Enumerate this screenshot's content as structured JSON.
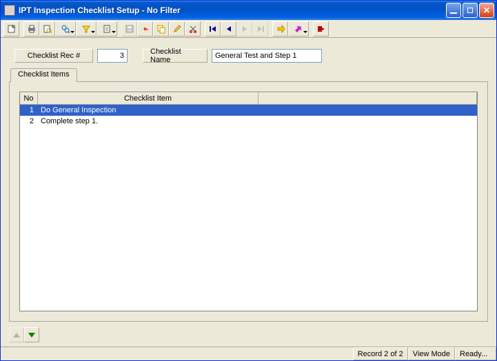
{
  "window": {
    "title": "IPT Inspection Checklist Setup - No Filter"
  },
  "form": {
    "rec_label": "Checklist Rec #",
    "rec_value": "3",
    "name_label": "Checklist Name",
    "name_value": "General Test and Step 1"
  },
  "tabs": {
    "items_label": "Checklist Items"
  },
  "grid": {
    "headers": {
      "no": "No",
      "item": "Checklist Item"
    },
    "rows": [
      {
        "no": "1",
        "item": "Do General Inspection"
      },
      {
        "no": "2",
        "item": "Complete step 1."
      }
    ]
  },
  "status": {
    "record": "Record 2 of 2",
    "mode": "View Mode",
    "ready": "Ready..."
  },
  "icons": {
    "new": "new-icon",
    "print": "print-icon",
    "preview": "preview-icon",
    "find": "find-icon",
    "filter": "filter-icon",
    "doc": "doc-icon",
    "save": "save-icon",
    "undo": "undo-icon",
    "copy": "copy-icon",
    "edit": "edit-icon",
    "cut": "cut-icon",
    "first": "first-icon",
    "prev": "prev-icon",
    "next": "next-icon",
    "last": "last-icon",
    "go": "go-icon",
    "help": "help-icon",
    "exit": "exit-icon"
  }
}
